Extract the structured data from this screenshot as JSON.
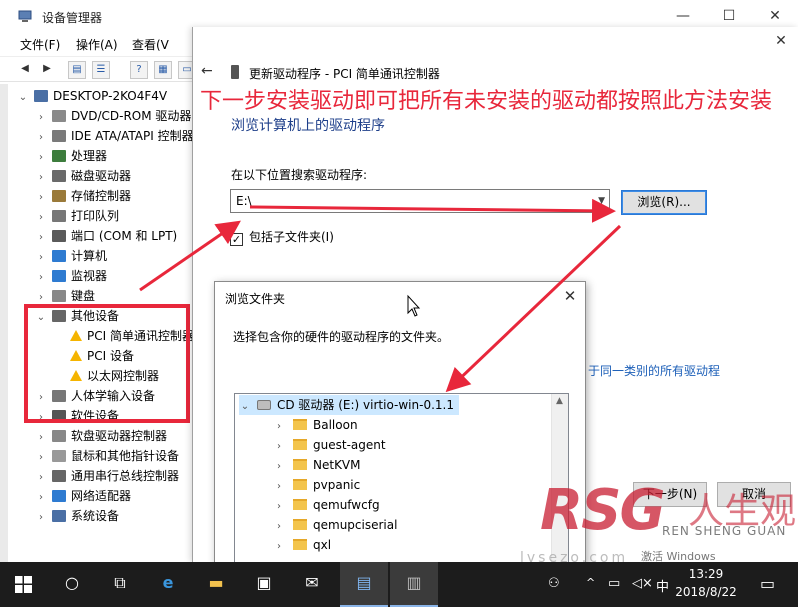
{
  "device_manager": {
    "title": "设备管理器",
    "menu": [
      "文件(F)",
      "操作(A)",
      "查看(V"
    ],
    "tree": [
      {
        "label": "DESKTOP-2KO4F4V",
        "level": 0,
        "expanded": true
      },
      {
        "label": "DVD/CD-ROM 驱动器",
        "level": 1
      },
      {
        "label": "IDE ATA/ATAPI 控制器",
        "level": 1
      },
      {
        "label": "处理器",
        "level": 1
      },
      {
        "label": "磁盘驱动器",
        "level": 1
      },
      {
        "label": "存储控制器",
        "level": 1
      },
      {
        "label": "打印队列",
        "level": 1
      },
      {
        "label": "端口 (COM 和 LPT)",
        "level": 1
      },
      {
        "label": "计算机",
        "level": 1
      },
      {
        "label": "监视器",
        "level": 1
      },
      {
        "label": "键盘",
        "level": 1
      },
      {
        "label": "其他设备",
        "level": 1,
        "expanded": true
      },
      {
        "label": "PCI 简单通讯控制器",
        "level": 2,
        "warning": true
      },
      {
        "label": "PCI 设备",
        "level": 2,
        "warning": true
      },
      {
        "label": "以太网控制器",
        "level": 2,
        "warning": true
      },
      {
        "label": "人体学输入设备",
        "level": 1
      },
      {
        "label": "软件设备",
        "level": 1
      },
      {
        "label": "软盘驱动器控制器",
        "level": 1
      },
      {
        "label": "鼠标和其他指针设备",
        "level": 1
      },
      {
        "label": "通用串行总线控制器",
        "level": 1
      },
      {
        "label": "网络适配器",
        "level": 1
      },
      {
        "label": "系统设备",
        "level": 1
      }
    ]
  },
  "update_driver": {
    "title": "更新驱动程序 - PCI 简单通讯控制器",
    "heading": "浏览计算机上的驱动程序",
    "search_label": "在以下位置搜索驱动程序:",
    "path_value": "E:\\",
    "browse_label": "浏览(R)...",
    "include_subfolders_label": "包括子文件夹(I)",
    "include_subfolders_checked": true,
    "list_link": "于同一类别的所有驱动程",
    "next_label": "下一步(N)",
    "cancel_label": "取消",
    "activate_text": "激活 Windows"
  },
  "annotation": {
    "text": "下一步安装驱动即可把所有未安装的驱动都按照此方法安装",
    "color": "#e8273b"
  },
  "browse_folder": {
    "title": "浏览文件夹",
    "message": "选择包含你的硬件的驱动程序的文件夹。",
    "drive_label": "CD 驱动器 (E:) virtio-win-0.1.1",
    "folders": [
      "Balloon",
      "guest-agent",
      "NetKVM",
      "pvpanic",
      "qemufwcfg",
      "qemupciserial",
      "qxl"
    ]
  },
  "watermark": {
    "logo": "RSG",
    "brand_cn": "人生观",
    "pinyin": "REN SHENG GUAN",
    "url": "lvsezo.com"
  },
  "taskbar": {
    "time": "13:29",
    "date": "2018/8/22",
    "ime": "中"
  }
}
